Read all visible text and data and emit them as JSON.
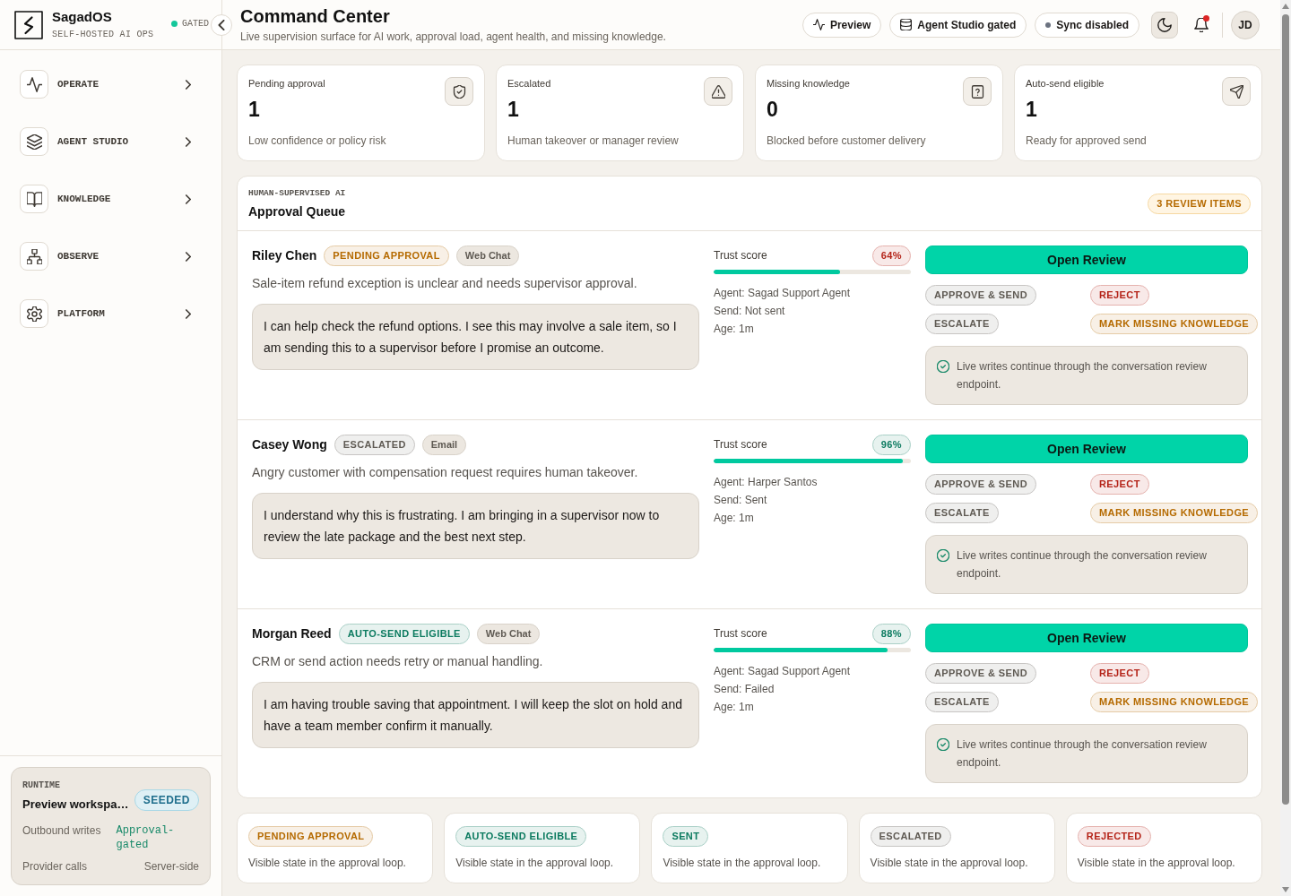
{
  "sidebar": {
    "brand": {
      "name": "SagadOS",
      "tagline": "SELF-HOSTED AI OPS"
    },
    "status": {
      "label": "GATED"
    },
    "nav": [
      {
        "label": "OPERATE",
        "expanded": false
      },
      {
        "label": "AGENT STUDIO",
        "expanded": false
      },
      {
        "label": "KNOWLEDGE",
        "expanded": false
      },
      {
        "label": "OBSERVE",
        "expanded": false
      },
      {
        "label": "PLATFORM",
        "expanded": false
      }
    ],
    "runtime": {
      "eyebrow": "RUNTIME",
      "title": "Preview workspa…",
      "badge": "SEEDED",
      "facts": [
        {
          "label": "Outbound writes",
          "value": "Approval-gated",
          "kind": "highlight"
        },
        {
          "label": "Provider calls",
          "value": "Server-side",
          "kind": "plain"
        }
      ]
    }
  },
  "header": {
    "title": "Command Center",
    "subtitle": "Live supervision surface for AI work, approval load, agent health, and missing knowledge.",
    "chips": [
      {
        "label": "Preview"
      },
      {
        "label": "Agent Studio gated"
      },
      {
        "label": "Sync disabled"
      }
    ],
    "notifications": {
      "unread": true
    },
    "avatar": {
      "initials": "JD"
    }
  },
  "stats": [
    {
      "label": "Pending approval",
      "value": "1",
      "note": "Low confidence or policy risk"
    },
    {
      "label": "Escalated",
      "value": "1",
      "note": "Human takeover or manager review"
    },
    {
      "label": "Missing knowledge",
      "value": "0",
      "note": "Blocked before customer delivery"
    },
    {
      "label": "Auto-send eligible",
      "value": "1",
      "note": "Ready for approved send"
    }
  ],
  "queue": {
    "eyebrow": "HUMAN-SUPERVISED AI",
    "title": "Approval Queue",
    "count_badge": "3 REVIEW ITEMS",
    "items": [
      {
        "customer": "Riley Chen",
        "status": {
          "label": "PENDING APPROVAL",
          "color": "#b56a00"
        },
        "channel": "Web Chat",
        "summary": "Sale-item refund exception is unclear and needs supervisor approval.",
        "draft": "I can help check the refund options. I see this may involve a sale item, so I am sending this to a supervisor before I promise an outcome.",
        "trust": {
          "label": "Trust score",
          "reading": "64%",
          "color": "#b42318",
          "level": 0.64
        },
        "meta": [
          "Agent: Sagad Support Agent",
          "Send: Not sent",
          "Age: 1m"
        ],
        "primary_action": "Open Review",
        "actions": [
          {
            "label": "APPROVE & SEND",
            "color": "#5f5a53"
          },
          {
            "label": "REJECT",
            "color": "#b42318"
          },
          {
            "label": "ESCALATE",
            "color": "#5f5a53"
          },
          {
            "label": "MARK MISSING KNOWLEDGE",
            "color": "#b56a00"
          }
        ],
        "note": "Live writes continue through the conversation review endpoint."
      },
      {
        "customer": "Casey Wong",
        "status": {
          "label": "ESCALATED",
          "color": "#5f5a53"
        },
        "channel": "Email",
        "summary": "Angry customer with compensation request requires human takeover.",
        "draft": "I understand why this is frustrating. I am bringing in a supervisor now to review the late package and the best next step.",
        "trust": {
          "label": "Trust score",
          "reading": "96%",
          "color": "#0b7a5f",
          "level": 0.96
        },
        "meta": [
          "Agent: Harper Santos",
          "Send: Sent",
          "Age: 1m"
        ],
        "primary_action": "Open Review",
        "actions": [
          {
            "label": "APPROVE & SEND",
            "color": "#5f5a53"
          },
          {
            "label": "REJECT",
            "color": "#b42318"
          },
          {
            "label": "ESCALATE",
            "color": "#5f5a53"
          },
          {
            "label": "MARK MISSING KNOWLEDGE",
            "color": "#b56a00"
          }
        ],
        "note": "Live writes continue through the conversation review endpoint."
      },
      {
        "customer": "Morgan Reed",
        "status": {
          "label": "AUTO-SEND ELIGIBLE",
          "color": "#0b7a5f"
        },
        "channel": "Web Chat",
        "summary": "CRM or send action needs retry or manual handling.",
        "draft": "I am having trouble saving that appointment. I will keep the slot on hold and have a team member confirm it manually.",
        "trust": {
          "label": "Trust score",
          "reading": "88%",
          "color": "#0b7a5f",
          "level": 0.88
        },
        "meta": [
          "Agent: Sagad Support Agent",
          "Send: Failed",
          "Age: 1m"
        ],
        "primary_action": "Open Review",
        "actions": [
          {
            "label": "APPROVE & SEND",
            "color": "#5f5a53"
          },
          {
            "label": "REJECT",
            "color": "#b42318"
          },
          {
            "label": "ESCALATE",
            "color": "#5f5a53"
          },
          {
            "label": "MARK MISSING KNOWLEDGE",
            "color": "#b56a00"
          }
        ],
        "note": "Live writes continue through the conversation review endpoint."
      }
    ]
  },
  "state_legend": [
    {
      "label": "PENDING APPROVAL",
      "color": "#b56a00",
      "description": "Visible state in the approval loop."
    },
    {
      "label": "AUTO-SEND ELIGIBLE",
      "color": "#0b7a5f",
      "description": "Visible state in the approval loop."
    },
    {
      "label": "SENT",
      "color": "#0b7a5f",
      "description": "Visible state in the approval loop."
    },
    {
      "label": "ESCALATED",
      "color": "#5f5a53",
      "description": "Visible state in the approval loop."
    },
    {
      "label": "REJECTED",
      "color": "#b42318",
      "description": "Visible state in the approval loop."
    }
  ]
}
